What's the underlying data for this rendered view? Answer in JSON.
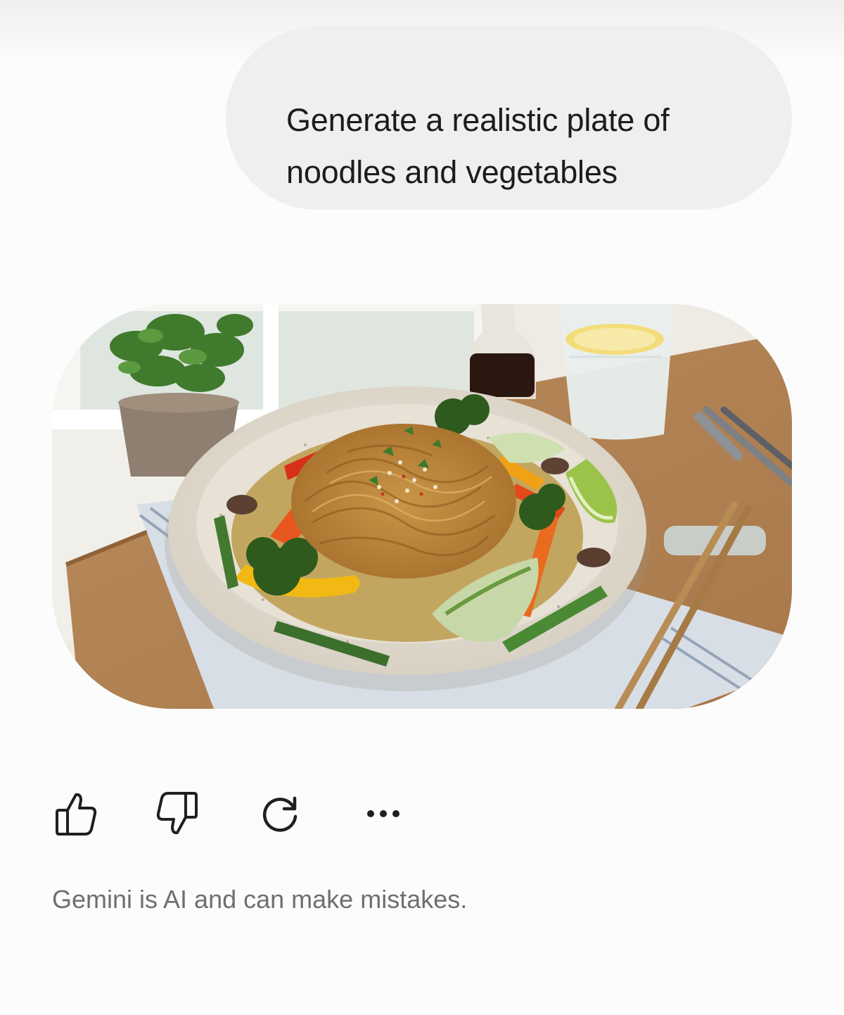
{
  "prompt": {
    "line1": "Generate a realistic plate of",
    "line2": "noodles and vegetables"
  },
  "response": {
    "image_subject": "plate of noodles and vegetables"
  },
  "actions": [
    {
      "name": "good-response",
      "icon": "thumbs-up-icon"
    },
    {
      "name": "bad-response",
      "icon": "thumbs-down-icon"
    },
    {
      "name": "regenerate",
      "icon": "refresh-icon"
    },
    {
      "name": "more-options",
      "icon": "more-horizontal-icon"
    }
  ],
  "footer": {
    "disclaimer": "Gemini is AI and can make mistakes."
  },
  "colors": {
    "bubble_bg": "#f0efef",
    "text_primary": "#1b1c1d",
    "text_secondary": "#6e6f72",
    "icon": "#1f1f1f"
  }
}
